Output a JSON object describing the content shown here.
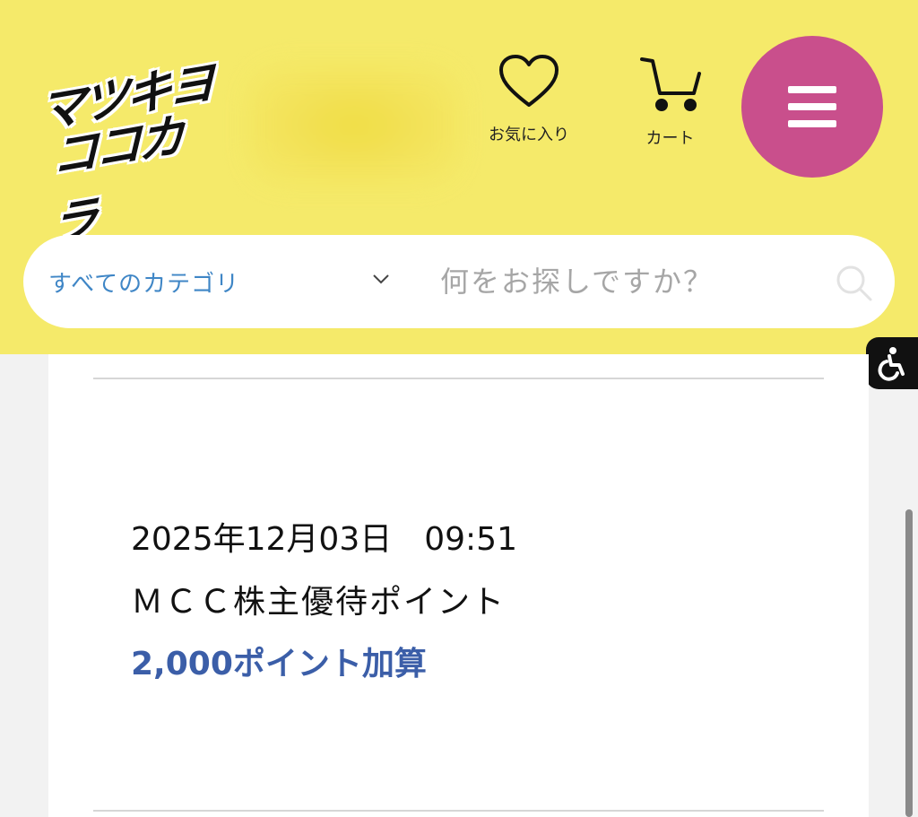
{
  "header": {
    "logo_line1": "マツキヨ",
    "logo_line2": "ココカラ",
    "favorites_label": "お気に入り",
    "cart_label": "カート",
    "menu_icon": "hamburger-icon"
  },
  "search": {
    "category_label": "すべてのカテゴリ",
    "placeholder": "何をお探しですか？",
    "icon": "search-icon"
  },
  "accessibility": {
    "icon": "accessibility-icon"
  },
  "history_entry": {
    "date": "2025年12月03日",
    "time": "09:51",
    "datetime": "2025年12月03日　09:51",
    "description": "ＭＣＣ株主優待ポイント",
    "points": "2,000ポイント加算"
  },
  "colors": {
    "header_bg": "#f5ea6a",
    "menu_button": "#c94f8c",
    "category_text": "#3f86c6",
    "points_text": "#3b5ea8"
  }
}
